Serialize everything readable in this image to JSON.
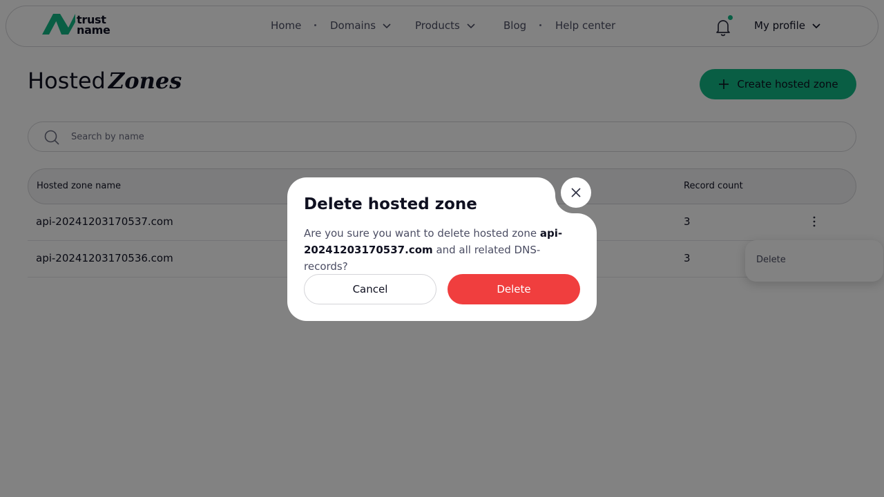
{
  "brand": {
    "line1": "trust",
    "line2": "name",
    "accent": "#12b886"
  },
  "nav": {
    "home": "Home",
    "domains": "Domains",
    "products": "Products",
    "blog": "Blog",
    "help": "Help center"
  },
  "header": {
    "profile": "My profile",
    "notification_dot": true
  },
  "page": {
    "title_plain": "Hosted",
    "title_emphasis": "Zones",
    "create_button": "Create hosted zone"
  },
  "search": {
    "placeholder": "Search by name",
    "value": ""
  },
  "table": {
    "columns": {
      "name": "Hosted zone name",
      "records": "Record count"
    },
    "rows": [
      {
        "name": "api-20241203170537.com",
        "records": "3"
      },
      {
        "name": "api-20241203170536.com",
        "records": "3"
      }
    ]
  },
  "context_menu": {
    "delete": "Delete"
  },
  "modal": {
    "title": "Delete hosted zone",
    "body_before": "Are you sure you want to delete hosted zone",
    "zone": "api-20241203170537.com",
    "body_after": "and all related DNS-records?",
    "cancel": "Cancel",
    "confirm": "Delete",
    "confirm_color": "#f03e3e"
  }
}
